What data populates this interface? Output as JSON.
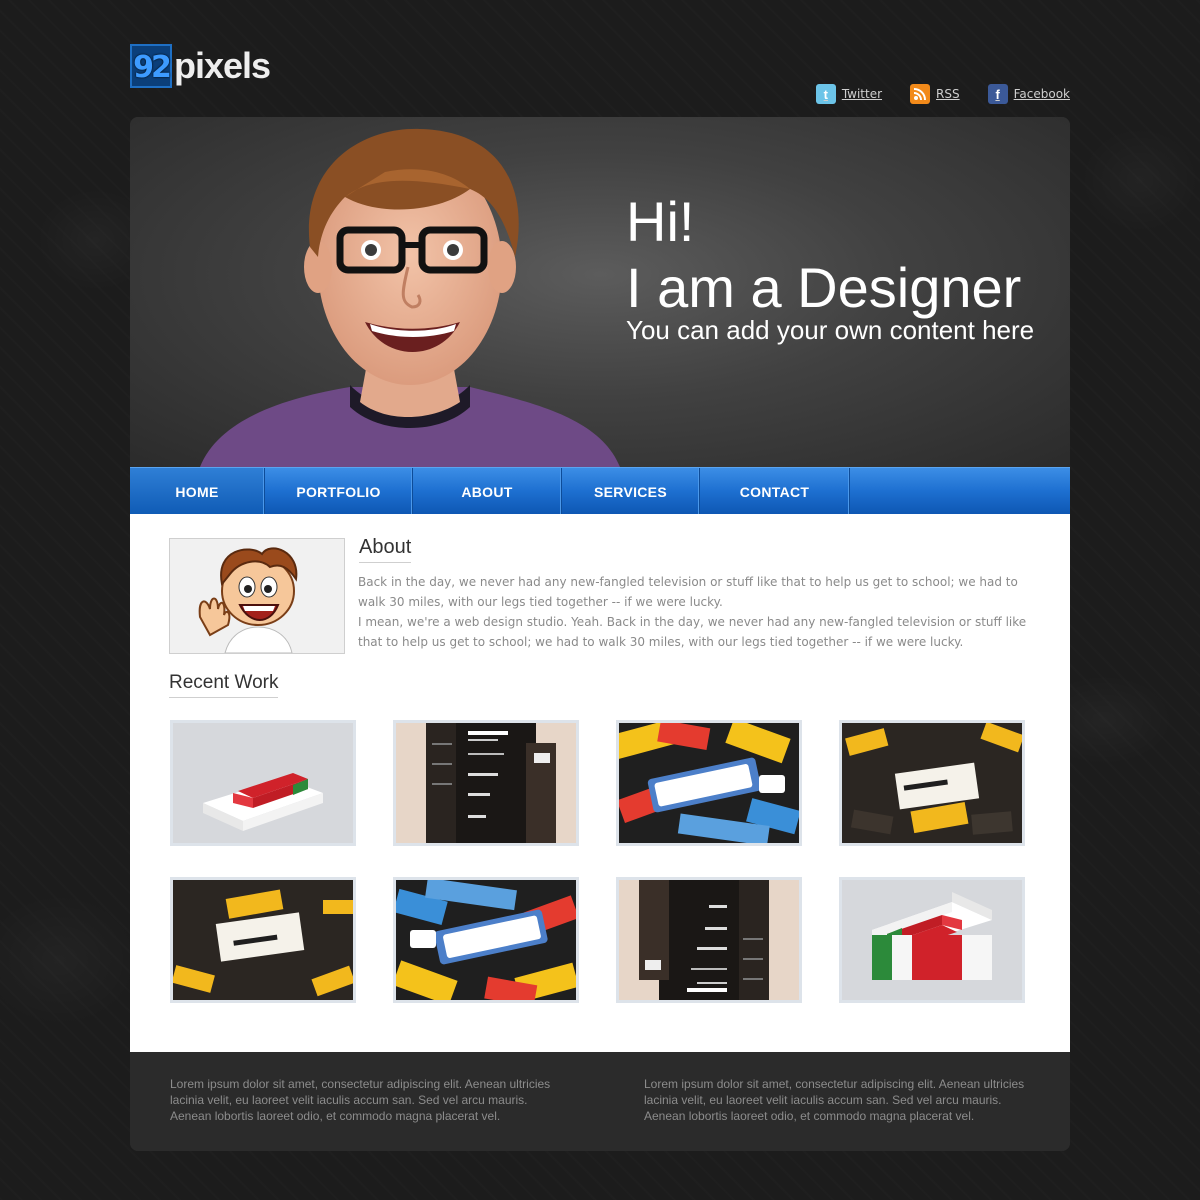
{
  "brand": {
    "mark": "92",
    "word": "pixels"
  },
  "social": [
    {
      "label": "Twitter",
      "icon": "twitter-icon"
    },
    {
      "label": "RSS",
      "icon": "rss-icon"
    },
    {
      "label": "Facebook",
      "icon": "facebook-icon"
    }
  ],
  "hero": {
    "greeting": "Hi!",
    "title": "I am a Designer",
    "subtitle": "You can add your own content here"
  },
  "nav": [
    "HOME",
    "PORTFOLIO",
    "ABOUT",
    "SERVICES",
    "CONTACT"
  ],
  "nav_active": "HOME",
  "about": {
    "heading": "About",
    "paragraphs": [
      "Back in the day, we never had any new-fangled television or stuff like that to help us get to school; we had to walk 30 miles, with our legs tied together -- if we were lucky.",
      "I mean, we're a web design studio. Yeah. Back in the day, we never had any new-fangled television or stuff like that to help us get to school; we had to walk 30 miles, with our legs tied together -- if we were lucky."
    ]
  },
  "recent_work": {
    "heading": "Recent Work",
    "items": [
      {
        "kind": "minicards-box"
      },
      {
        "kind": "river-banner"
      },
      {
        "kind": "say-it-in-print"
      },
      {
        "kind": "rockable-cards"
      },
      {
        "kind": "rockable-cards"
      },
      {
        "kind": "say-it-in-print"
      },
      {
        "kind": "river-banner"
      },
      {
        "kind": "minicards-box"
      }
    ]
  },
  "footer": {
    "left": "Lorem ipsum dolor sit amet, consectetur adipiscing elit. Aenean ultricies lacinia velit, eu laoreet velit iaculis accum san. Sed vel arcu mauris. Aenean lobortis laoreet odio, et commodo magna placerat vel.",
    "right": "Lorem ipsum dolor sit amet, consectetur adipiscing elit. Aenean ultricies lacinia velit, eu laoreet velit iaculis accum san. Sed vel arcu mauris. Aenean lobortis laoreet odio, et commodo magna placerat vel."
  },
  "colors": {
    "nav_blue": "#1d6fd0",
    "page_bg": "#1c1c1c",
    "content_bg": "#ffffff"
  }
}
